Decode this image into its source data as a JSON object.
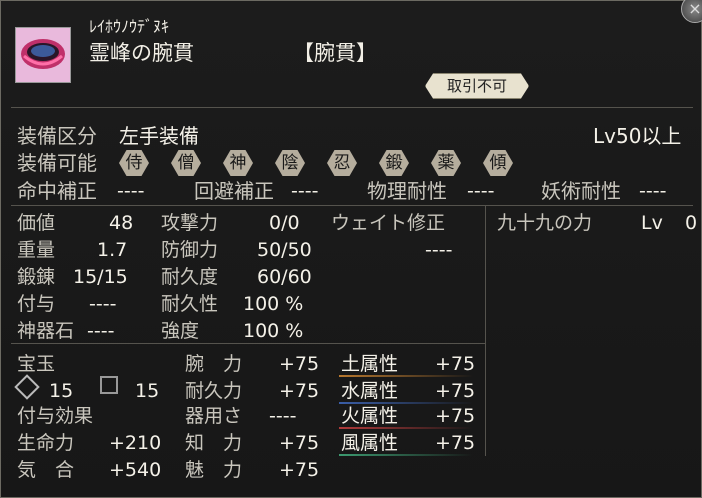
{
  "item": {
    "reading": "ﾚｲﾎｳﾉｳﾃﾞﾇｷ",
    "name": "霊峰の腕貫",
    "category": "【腕貫】",
    "trade": "取引不可",
    "icon": "bracelet-icon"
  },
  "equip": {
    "slot_label": "装備区分",
    "slot_value": "左手装備",
    "level_req": "Lv50以上",
    "classes_label": "装備可能",
    "classes": [
      "侍",
      "僧",
      "神",
      "陰",
      "忍",
      "鍛",
      "薬",
      "傾"
    ]
  },
  "bonus_row": {
    "hit_label": "命中補正",
    "hit_value": "----",
    "evade_label": "回避補正",
    "evade_value": "----",
    "phys_label": "物理耐性",
    "phys_value": "----",
    "magic_label": "妖術耐性",
    "magic_value": "----"
  },
  "stats": {
    "price_label": "価値",
    "price": "48",
    "weight_label": "重量",
    "weight": "1.7",
    "forge_label": "鍛錬",
    "forge": "15/15",
    "enchant_label": "付与",
    "enchant": "----",
    "relic_label": "神器石",
    "relic": "----",
    "atk_label": "攻撃力",
    "atk": "0/0",
    "def_label": "防御力",
    "def": "50/50",
    "dur_label": "耐久度",
    "dur": "60/60",
    "durp_label": "耐久性",
    "durp": "100 %",
    "str_label": "強度",
    "str": "100 %",
    "weight_mod_label": "ウェイト修正",
    "weight_mod": "----"
  },
  "special": {
    "name": "九十九の力",
    "lv_label": "Lv",
    "lv": "0"
  },
  "gems": {
    "label": "宝玉",
    "slot1": "15",
    "slot2": "15",
    "effects_label": "付与効果"
  },
  "effects_left": [
    {
      "label": "生命力",
      "value": "+210"
    },
    {
      "label": "気　合",
      "value": "+540"
    }
  ],
  "effects_mid": [
    {
      "label": "腕　力",
      "value": "+75"
    },
    {
      "label": "耐久力",
      "value": "+75"
    },
    {
      "label": "器用さ",
      "value": "----"
    },
    {
      "label": "知　力",
      "value": "+75"
    },
    {
      "label": "魅　力",
      "value": "+75"
    }
  ],
  "elements": [
    {
      "label": "土属性",
      "value": "+75",
      "color": "#b8782e"
    },
    {
      "label": "水属性",
      "value": "+75",
      "color": "#3a5ea8"
    },
    {
      "label": "火属性",
      "value": "+75",
      "color": "#b03a3a"
    },
    {
      "label": "風属性",
      "value": "+75",
      "color": "#3c9a70"
    }
  ]
}
